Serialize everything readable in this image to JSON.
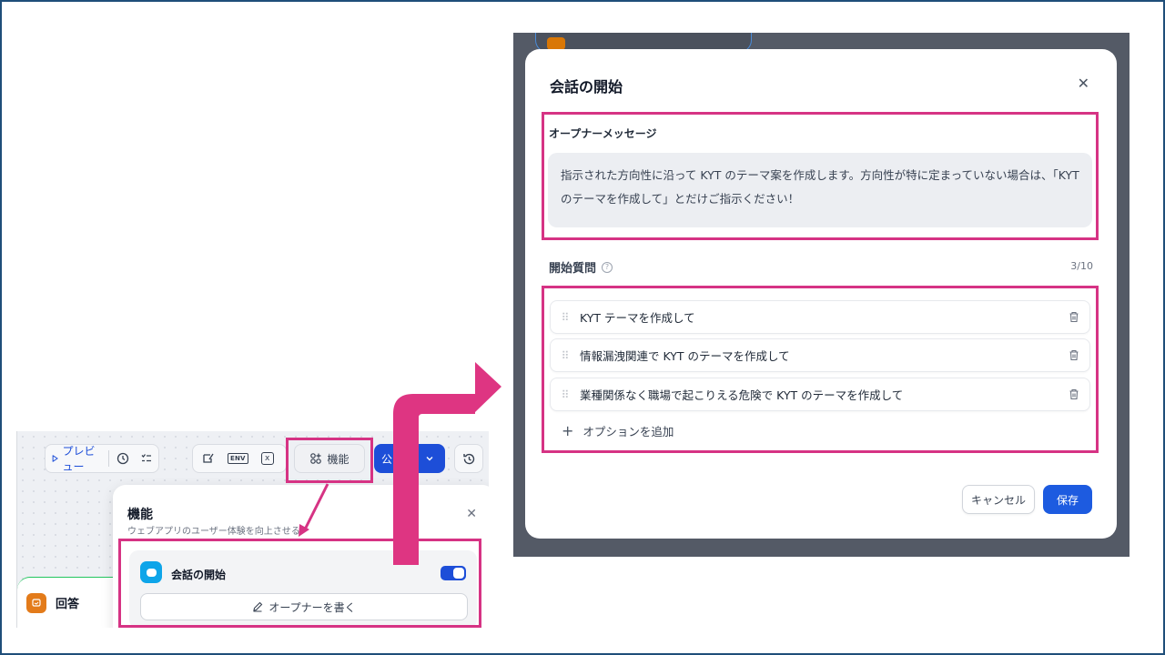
{
  "left_panel": {
    "toolbar": {
      "preview_label": "プレビュー",
      "features_label": "機能",
      "publish_label": "公"
    },
    "node_label": "回答",
    "feature_panel": {
      "title": "機能",
      "subtitle": "ウェブアプリのユーザー体験を向上させる",
      "card_label": "会話の開始",
      "toggle_on": true,
      "write_button_label": "オープナーを書く"
    }
  },
  "modal": {
    "title": "会話の開始",
    "opener_label": "オープナーメッセージ",
    "opener_text": "指示された方向性に沿って KYT のテーマ案を作成します。方向性が特に定まっていない場合は、「KYT のテーマを作成して」とだけご指示ください！",
    "questions_label": "開始質問",
    "questions_count": "3/10",
    "questions": [
      "KYT テーマを作成して",
      "情報漏洩関連で KYT のテーマを作成して",
      "業種関係なく職場で起こりえる危険で KYT のテーマを作成して"
    ],
    "add_option_label": "オプションを追加",
    "cancel_label": "キャンセル",
    "save_label": "保存"
  },
  "colors": {
    "highlight": "#d63384",
    "accent_blue": "#1d4ed8",
    "overlay": "#545a66"
  }
}
